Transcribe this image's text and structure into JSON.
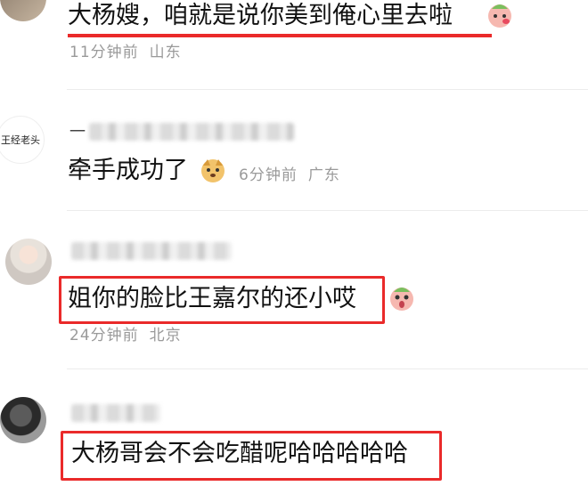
{
  "comments": [
    {
      "text": "大杨嫂，咱就是说你美到俺心里去啦",
      "time": "11分钟前",
      "location": "山东",
      "emoji": "blushing-face-icon"
    },
    {
      "avatar_label": "王经老头",
      "username": "一",
      "text": "牵手成功了",
      "time": "6分钟前",
      "location": "广东",
      "emoji": "dog-face-icon"
    },
    {
      "text": "姐你的脸比王嘉尔的还小哎",
      "time": "24分钟前",
      "location": "北京",
      "emoji": "shocked-face-icon"
    },
    {
      "text": "大杨哥会不会吃醋呢哈哈哈哈哈",
      "emoji": ""
    }
  ],
  "highlight_color": "#ea2a2a"
}
